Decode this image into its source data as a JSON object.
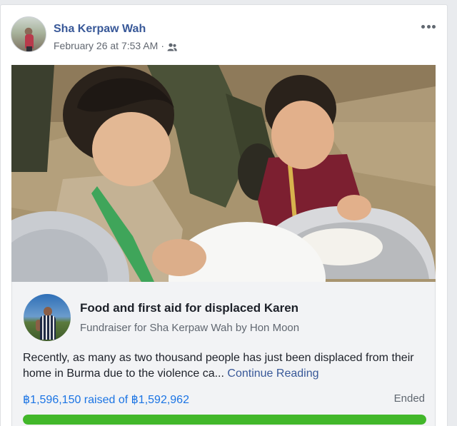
{
  "post": {
    "author_name": "Sha Kerpaw Wah",
    "timestamp": "February 26 at 7:53 AM",
    "separator": "·",
    "audience_icon": "friends-icon",
    "more_icon": "more-options-icon"
  },
  "fundraiser": {
    "title": "Food and first aid for displaced Karen",
    "subtitle": "Fundraiser for Sha Kerpaw Wah by Hon Moon",
    "description": "Recently, as many as two thousand people has just been displaced from their home in Burma due to the violence ca...",
    "continue_label": "Continue Reading",
    "raised_text": "฿1,596,150 raised of ฿1,592,962",
    "status": "Ended",
    "progress_fraction": 1.0
  },
  "colors": {
    "link": "#385898",
    "raised": "#1b74e4",
    "progress": "#42b72a"
  }
}
